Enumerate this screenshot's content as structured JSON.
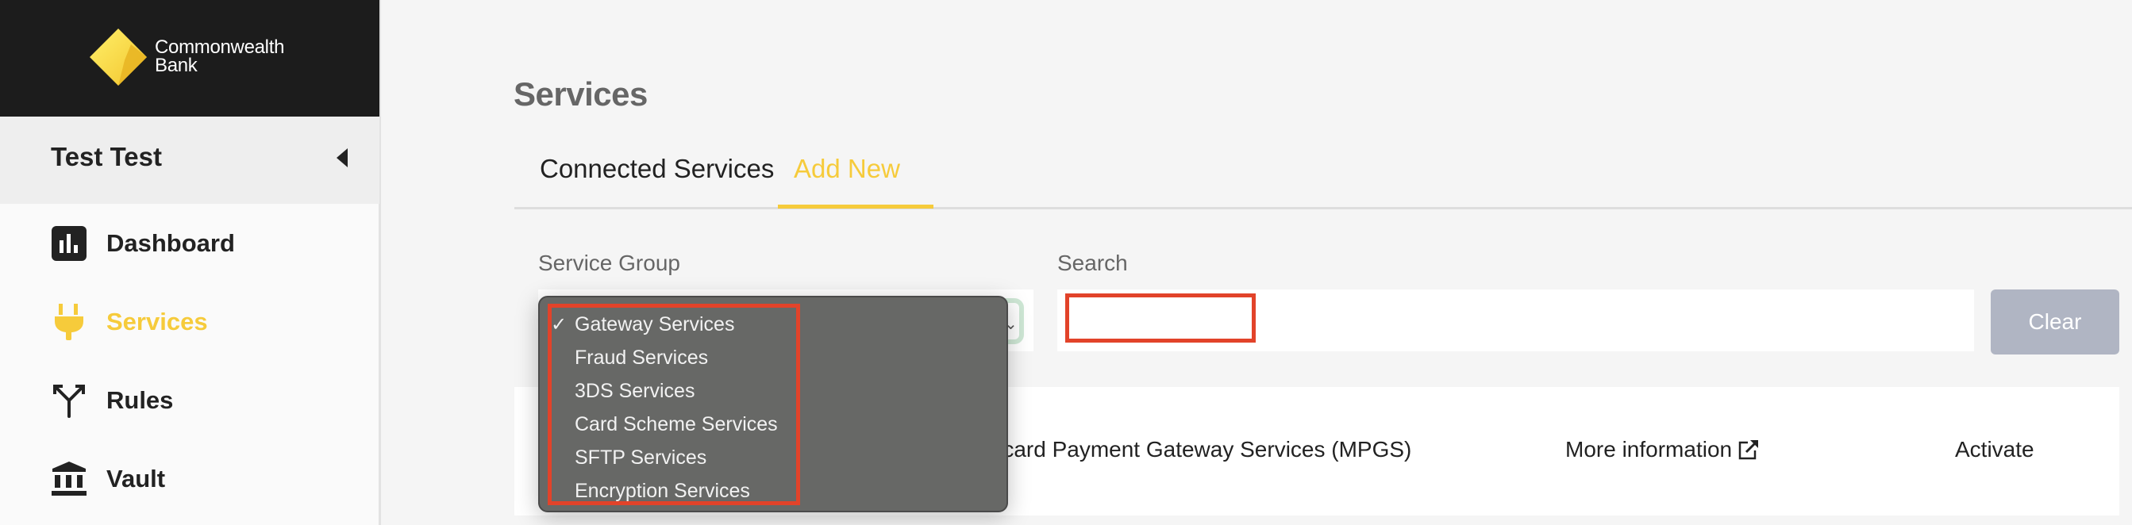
{
  "brand": {
    "name_line1": "Commonwealth",
    "name_line2": "Bank",
    "logo_icon": "diamond-logo-icon",
    "accent_color": "#f6cb3b"
  },
  "sidebar": {
    "user_name": "Test Test",
    "collapse_icon": "caret-left-icon",
    "items": [
      {
        "label": "Dashboard",
        "icon": "bar-chart-icon",
        "active": false
      },
      {
        "label": "Services",
        "icon": "plug-icon",
        "active": true
      },
      {
        "label": "Rules",
        "icon": "fork-icon",
        "active": false
      },
      {
        "label": "Vault",
        "icon": "bank-building-icon",
        "active": false
      }
    ]
  },
  "main": {
    "title": "Services",
    "tabs": [
      {
        "label": "Connected Services",
        "active": false
      },
      {
        "label": "Add New",
        "active": true
      }
    ],
    "filters": {
      "service_group_label": "Service Group",
      "service_group_selected": "Gateway Services",
      "service_group_options": [
        "Gateway Services",
        "Fraud Services",
        "3DS Services",
        "Card Scheme Services",
        "SFTP Services",
        "Encryption Services"
      ],
      "search_label": "Search",
      "search_value": "",
      "clear_label": "Clear"
    },
    "services": [
      {
        "name": "rcard Payment Gateway Services (MPGS)",
        "more_info_label": "More information",
        "more_info_icon": "external-link-icon",
        "action_label": "Activate"
      }
    ]
  }
}
